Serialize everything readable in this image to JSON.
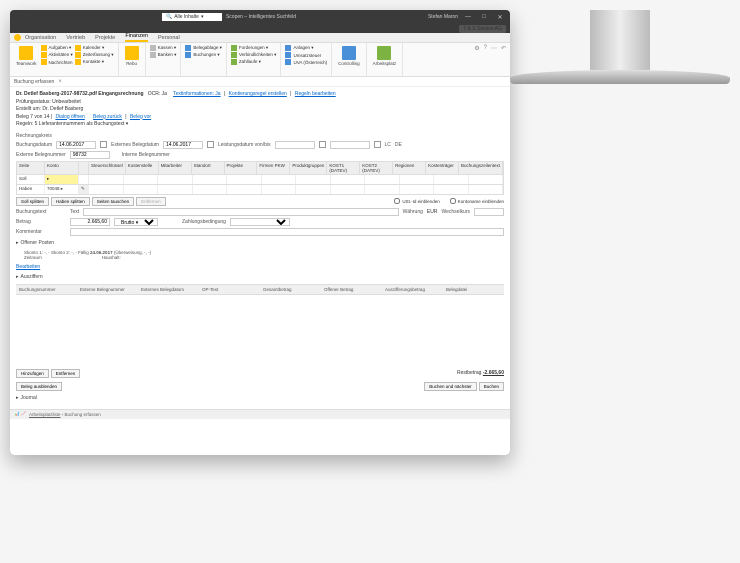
{
  "titlebar": {
    "search_placeholder": "Alle Inhalte",
    "app_title": "Scopen – Intelligentes Suchfeld",
    "user": "Stefan Maron",
    "company": "T & S Service AG"
  },
  "menu": {
    "items": [
      "Organisation",
      "Vertrieb",
      "Projekte",
      "Finanzen",
      "Personal"
    ],
    "active": 3
  },
  "ribbon": {
    "g1": {
      "large": "Teamwork",
      "items": [
        "Aufgaben ▾",
        "Aktivitäten ▾",
        "Kontakte ▾",
        "Nachrichten"
      ],
      "label": "",
      "cal": "Kalender ▾",
      "ze": "Zeiterfassung ▾"
    },
    "g2": {
      "large": "Rebu",
      "label": ""
    },
    "g3": {
      "items": [
        "Kassen ▾",
        "Banken ▾"
      ]
    },
    "g4": {
      "items": [
        "Belegablage ▾",
        "Buchungen ▾"
      ]
    },
    "g5": {
      "items": [
        "Forderungen ▾",
        "Verbindlichkeiten ▾",
        "Zahllaufe ▾"
      ]
    },
    "g6": {
      "items": [
        "Anlagen ▾",
        "Umsatzsteuer",
        "UVA (Österreich)"
      ]
    },
    "g7": "Controlling",
    "g8": "Arbeitsplatz"
  },
  "tab": {
    "label": "Buchung erfassen"
  },
  "doc": {
    "filename": "Dr. Detlef Basberg-2017-98732.pdf",
    "type": "Eingangsrechnung",
    "ocr": "OCR: Ja",
    "links": [
      "Textinformationen: Ja",
      "Kontierungsregel erstellen",
      "Regeln bearbeiten"
    ],
    "status_label": "Prüfungsstatus:",
    "status": "Unbearbeitet",
    "erstellt_label": "Erstellt um:",
    "erstellt": "Dr. Detlef Basberg",
    "beleg": "Beleg 7 von 14",
    "beleg_links": [
      "Dialog öffnen",
      "Beleg zurück",
      "Beleg vor"
    ],
    "regeln_label": "Regeln:",
    "regeln": "5 Lieferantennummern als Buchungstext"
  },
  "form": {
    "rechnungskreis": "Rechnungskreis",
    "buchungsdatum": "Buchungsdatum",
    "bd_val": "14.06.2017",
    "ext_bd": "Externes Belegdatum",
    "ext_bd_val": "14.06.2017",
    "leist": "Leistungsdatum von/bis",
    "lc": "LC",
    "de": "DE",
    "ext_bn": "Externe Belegnummer",
    "ext_bn_val": "98732",
    "int_bn": "Interne Belegnummer"
  },
  "table": {
    "cols": [
      "Seite",
      "Konto",
      "",
      "Steuerschlüssel",
      "Kostenstelle",
      "Mitarbeiter",
      "Standort",
      "Projekte",
      "Firmen PKW",
      "Produktgruppen",
      "KOST1 (DATEV)",
      "KOST2 (DATEV)",
      "Regionen",
      "Kostenträger",
      "Buchungszeilentext"
    ],
    "rows": [
      {
        "seite": "Soll",
        "konto": ""
      },
      {
        "seite": "Haben",
        "konto": "70048"
      }
    ]
  },
  "buttons": {
    "split": "Soll splitten",
    "hsplit": "Haben splitten",
    "swap": "Seiten tauschen",
    "del": "Entfernen"
  },
  "checks": {
    "ust": "USt.-Id einblenden",
    "konto": "Kontoname einblenden"
  },
  "lower": {
    "buchungstext": "Buchungstext",
    "text": "Text",
    "wahrung": "Währung",
    "eur": "EUR",
    "kurs": "Wechselkurs",
    "betrag": "Betrag",
    "betrag_val": "2.665,60",
    "brutto": "Brutto ▾",
    "zb": "Zahlungsbedingung",
    "kommentar": "Kommentar"
  },
  "op": {
    "title": "Offener Posten",
    "line": "Skonto 1: -, -  Skonto 2: -, -  Fällig",
    "date": "24.06.2017",
    "ueber": "(Überweisung, -, -)",
    "zeilraum": "Zeitraum",
    "haushalt": "Haushalt:",
    "bearb": "Bearbeiten"
  },
  "ausz": {
    "title": "Ausziffern",
    "cols": [
      "Buchungsnummer",
      "Externe Belegnummer",
      "Externes Belegdatum",
      "OP-Text",
      "Gesamtbetrag",
      "Offener Betrag",
      "Auszifferungsbetrag",
      "Belegdatei"
    ]
  },
  "footer": {
    "add": "Hinzufügen",
    "remove": "Entfernen",
    "hide": "Beleg ausblenden",
    "rest_label": "Restbetrag",
    "rest_val": "-2.665,60",
    "next": "Buchen und nächster",
    "book": "Buchen",
    "journal": "Journal"
  },
  "status": {
    "crumb1": "Arbeitsplatzliste",
    "crumb2": "Buchung erfassen"
  }
}
